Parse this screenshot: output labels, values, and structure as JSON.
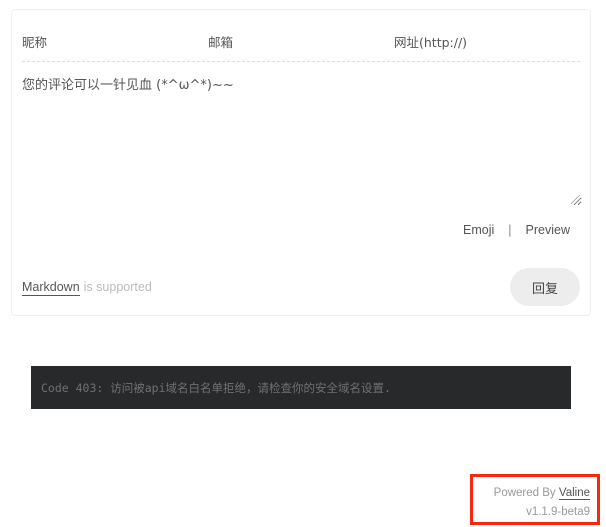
{
  "comment_form": {
    "nick_placeholder": "昵称",
    "mail_placeholder": "邮箱",
    "link_placeholder": "网址(http://)",
    "comment_placeholder": "您的评论可以一针见血 (*^ω^*)~~",
    "tools": {
      "emoji_label": "Emoji",
      "separator": "|",
      "preview_label": "Preview"
    },
    "markdown_link": "Markdown",
    "markdown_suffix": "is supported",
    "submit_label": "回复"
  },
  "error": {
    "message": "Code 403: 访问被api域名白名单拒绝，请检查你的安全域名设置."
  },
  "powered": {
    "prefix": "Powered By",
    "brand": "Valine",
    "version": "v1.1.9-beta9"
  },
  "colors": {
    "highlight_border": "#f4290f",
    "error_bg": "#27292b",
    "submit_bg": "#ededed"
  }
}
